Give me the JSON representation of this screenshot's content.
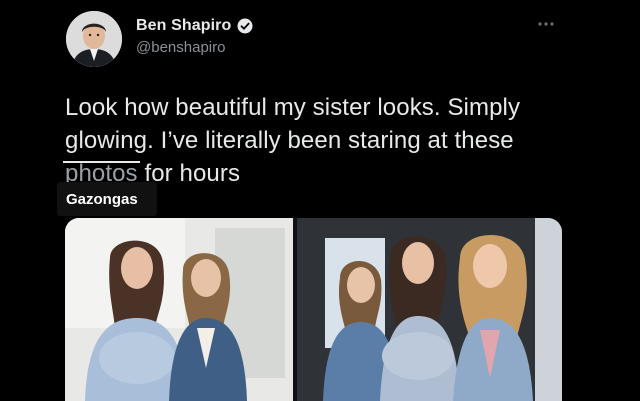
{
  "tweet": {
    "display_name": "Ben Shapiro",
    "handle": "@benshapiro",
    "text_line_1": "Look how beautiful my sister looks. Simply",
    "text_line_2": "glowing. I’ve literally been staring at these",
    "struck_word": "photos",
    "text_line_3_rest": " for hours",
    "caption_label": "Gazongas"
  },
  "icons": {
    "verified": "verified-badge-icon",
    "more": "more-options-icon"
  },
  "colors": {
    "background": "#000000",
    "text_primary": "#e7e9ea",
    "text_secondary": "#8b9196"
  }
}
